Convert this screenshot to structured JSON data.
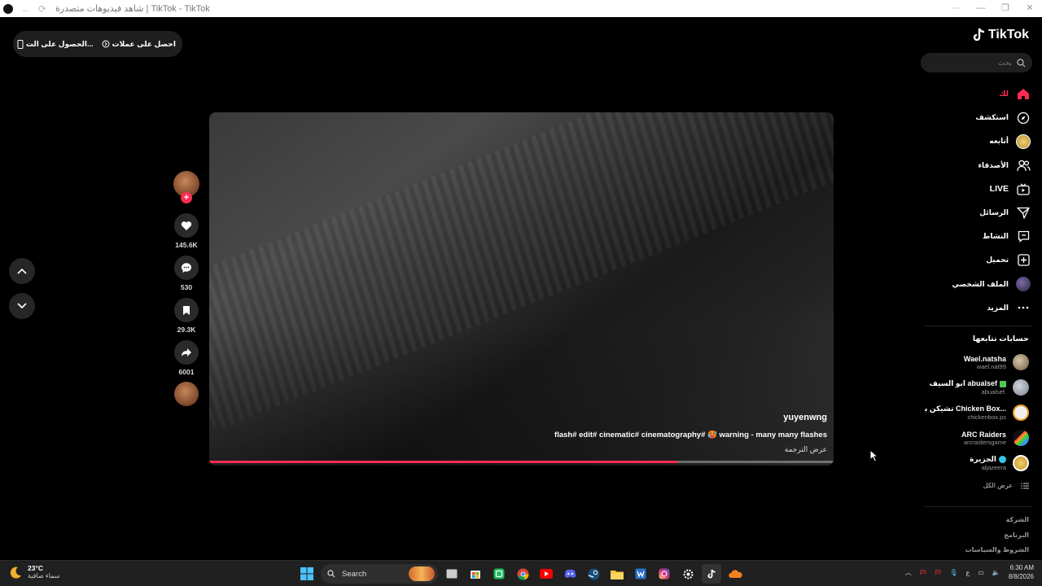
{
  "window": {
    "title": "شاهد فيديوهات متصدرة | TikTok - TikTok"
  },
  "promo": {
    "coins_label": "احصل على عملات",
    "app_label": "الحصول على الت..."
  },
  "brand": {
    "name": "TikTok"
  },
  "search": {
    "placeholder": "بحث"
  },
  "nav": {
    "items": [
      {
        "label": "لك",
        "icon": "home-icon"
      },
      {
        "label": "استكشف",
        "icon": "compass-icon"
      },
      {
        "label": "أتابعه",
        "icon": "following-avatar-icon"
      },
      {
        "label": "الأصدقاء",
        "icon": "friends-icon"
      },
      {
        "label": "LIVE",
        "icon": "live-tv-icon"
      },
      {
        "label": "الرسائل",
        "icon": "send-icon"
      },
      {
        "label": "النشاط",
        "icon": "activity-icon"
      },
      {
        "label": "تحميل",
        "icon": "upload-icon"
      },
      {
        "label": "الملف الشخصي",
        "icon": "profile-avatar-icon"
      },
      {
        "label": "المزيد",
        "icon": "more-icon"
      }
    ]
  },
  "following": {
    "title": "حسابات تتابعها",
    "accounts": [
      {
        "name": "Wael.natsha",
        "handle": "wael.nat99"
      },
      {
        "name": "ابو السيف abualsef",
        "handle": "abualsef."
      },
      {
        "name": "تشيكن بوكس Chicken Box...",
        "handle": "chickenbox.ps"
      },
      {
        "name": "ARC Raiders",
        "handle": "arcraidersgame"
      },
      {
        "name": "الجزيرة",
        "handle": "aljazeera"
      }
    ],
    "see_all": "عرض الكل"
  },
  "footer": {
    "links": [
      "الشركة",
      "البرنامج",
      "الشروط والسياسات"
    ]
  },
  "video": {
    "author": "yuyenwng",
    "caption": "flash# edit# cinematic# cinematography# 🥵 warning - many many flashes",
    "translate": "عرض الترجمة",
    "progress": 0.75
  },
  "actions": {
    "likes": "145.6K",
    "comments": "530",
    "saves": "29.3K",
    "shares": "6001"
  },
  "taskbar": {
    "temperature": "23°C",
    "weather": "سماء صافية",
    "search": "Search",
    "time": "6:30 AM",
    "date": "8/8/2026",
    "lang": "ع"
  },
  "colors": {
    "accent": "#fe2c55",
    "background": "#000000"
  }
}
